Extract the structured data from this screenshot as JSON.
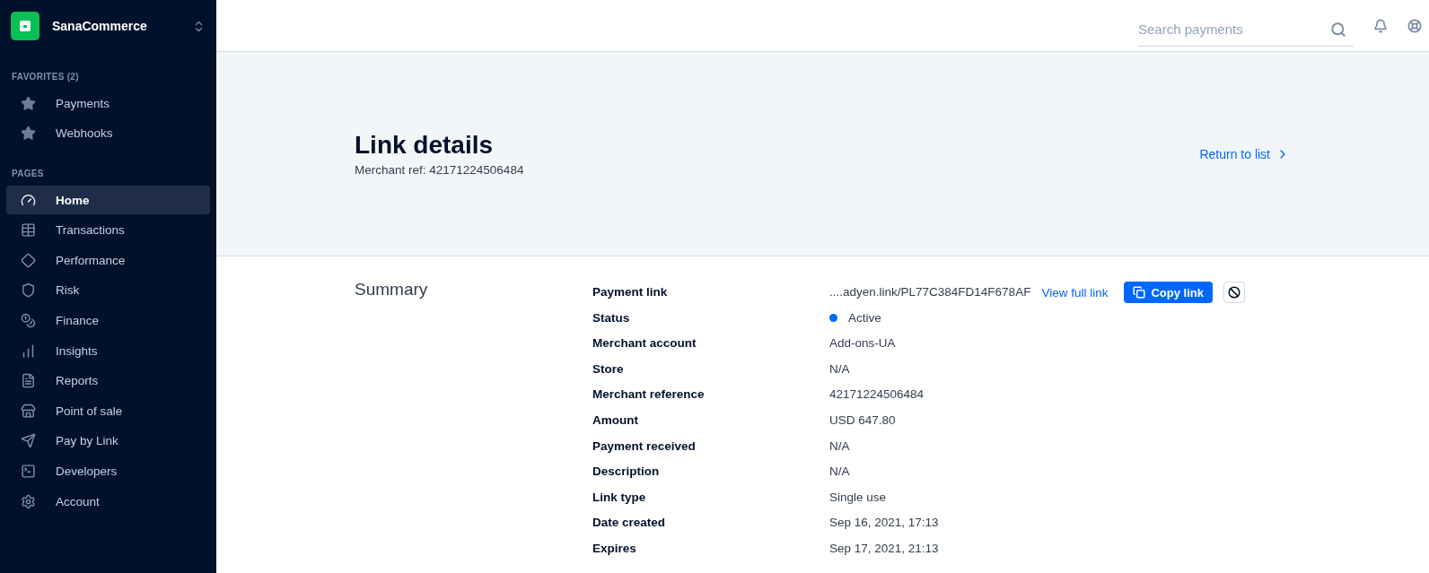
{
  "sidebar": {
    "account": "SanaCommerce",
    "favorites_heading": "FAVORITES (2)",
    "favorites": [
      {
        "label": "Payments"
      },
      {
        "label": "Webhooks"
      }
    ],
    "pages_heading": "PAGES",
    "pages": [
      {
        "label": "Home",
        "selected": true
      },
      {
        "label": "Transactions",
        "selected": false
      },
      {
        "label": "Performance",
        "selected": false
      },
      {
        "label": "Risk",
        "selected": false
      },
      {
        "label": "Finance",
        "selected": false
      },
      {
        "label": "Insights",
        "selected": false
      },
      {
        "label": "Reports",
        "selected": false
      },
      {
        "label": "Point of sale",
        "selected": false
      },
      {
        "label": "Pay by Link",
        "selected": false
      },
      {
        "label": "Developers",
        "selected": false
      },
      {
        "label": "Account",
        "selected": false
      }
    ]
  },
  "header": {
    "search": {
      "placeholder": "Search payments"
    }
  },
  "hero": {
    "title": "Link details",
    "subtitle": "Merchant ref: 42171224506484",
    "return_link": "Return to list"
  },
  "summary": {
    "heading": "Summary",
    "rows": [
      {
        "kind": "link",
        "label": "Payment link",
        "value": "....adyen.link/PL77C384FD14F678AF",
        "view_link": "View full link",
        "copy_button": "Copy link"
      },
      {
        "kind": "status",
        "label": "Status",
        "value": "Active",
        "color": "#0066ff"
      },
      {
        "kind": "text",
        "label": "Merchant account",
        "value": "Add-ons-UA"
      },
      {
        "kind": "text",
        "label": "Store",
        "value": "N/A"
      },
      {
        "kind": "text",
        "label": "Merchant reference",
        "value": "42171224506484"
      },
      {
        "kind": "text",
        "label": "Amount",
        "value": "USD 647.80"
      },
      {
        "kind": "text",
        "label": "Payment received",
        "value": "N/A"
      },
      {
        "kind": "text",
        "label": "Description",
        "value": "N/A"
      },
      {
        "kind": "text",
        "label": "Link type",
        "value": "Single use"
      },
      {
        "kind": "text",
        "label": "Date created",
        "value": "Sep 16, 2021, 17:13"
      },
      {
        "kind": "text",
        "label": "Expires",
        "value": "Sep 17, 2021, 21:13"
      }
    ]
  }
}
